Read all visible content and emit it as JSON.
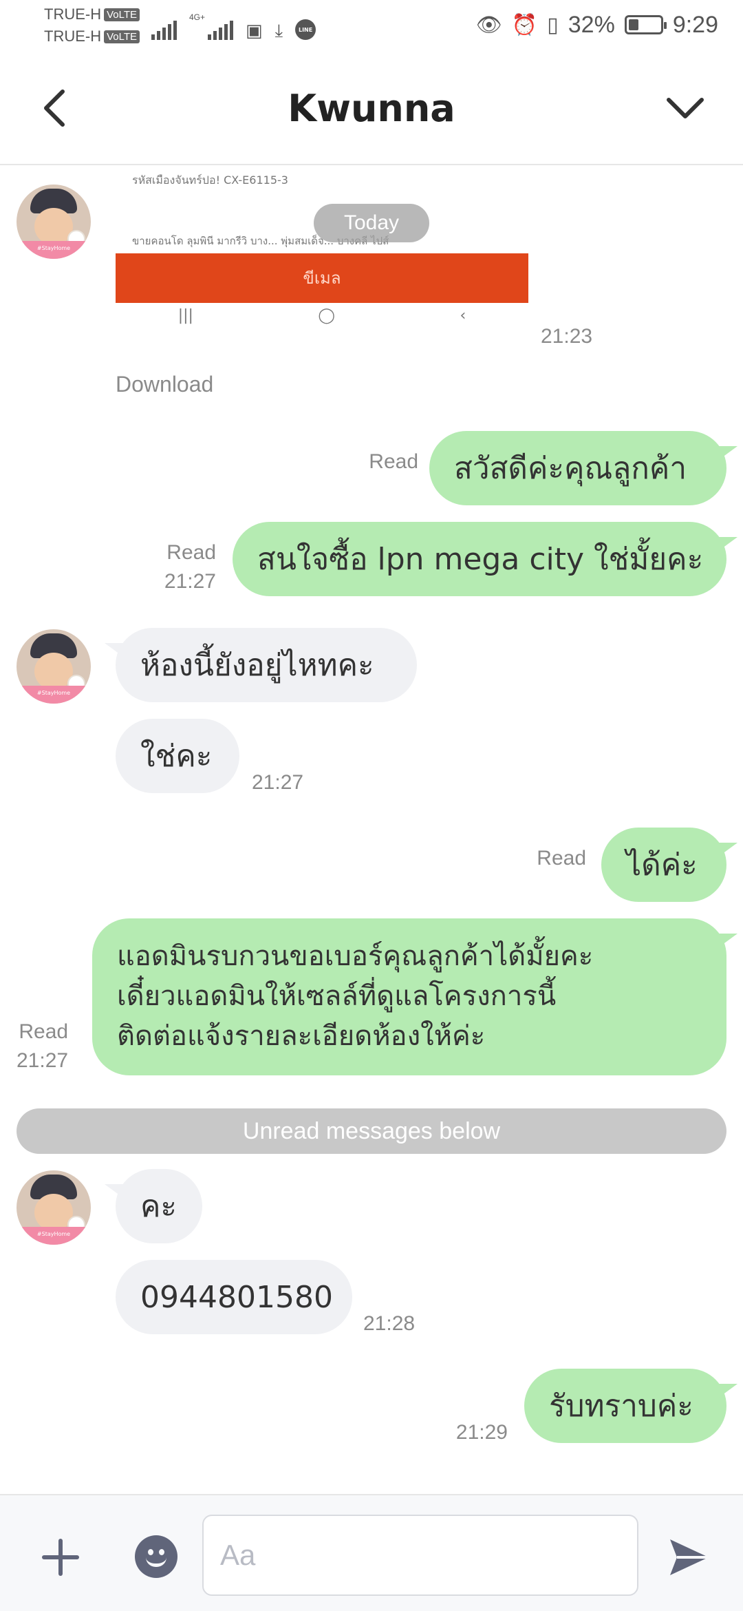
{
  "status_bar": {
    "carrier_1": "TRUE-H",
    "carrier_2": "TRUE-H",
    "volte": "VoLTE",
    "network": "4G+",
    "line_badge": "LINE",
    "battery": "32%",
    "battery_level": 0.32,
    "time": "9:29"
  },
  "header": {
    "title": "Kwunna",
    "back_icon": "chevron-left-icon",
    "menu_icon": "chevron-down-icon"
  },
  "chat": {
    "date_divider": "Today",
    "image_message": {
      "line1": "รหัสเมืองจันทร์ปอ! CX-E6115-3",
      "line2": "ขายคอนโด ลุมพินี มากรีวิ บาง... พุ่มสมเด็จ... บางคลี ไปส์",
      "button_text": "ขีเมล",
      "time": "21:23",
      "download_label": "Download"
    },
    "msg_out_1": {
      "text": "สวัสดีค่ะคุณลูกค้า",
      "read": "Read"
    },
    "msg_out_2": {
      "text": "สนใจซื้อ lpn mega city ใช่มั้ยคะ",
      "read": "Read",
      "time": "21:27"
    },
    "msg_in_1": {
      "text": "ห้องนี้ยังอยู่ไหทคะ"
    },
    "msg_in_2": {
      "text": "ใช่คะ",
      "time": "21:27"
    },
    "msg_out_3": {
      "text": "ได้ค่ะ",
      "read": "Read"
    },
    "msg_out_4": {
      "line1": "แอดมินรบกวนขอเบอร์คุณลูกค้าได้มั้ยคะ",
      "line2": "เดี๋ยวแอดมินให้เซลล์ที่ดูแลโครงการนี้",
      "line3": "ติดต่อแจ้งรายละเอียดห้องให้ค่ะ",
      "read": "Read",
      "time": "21:27"
    },
    "unread_divider": "Unread messages below",
    "msg_in_3": {
      "text": "คะ"
    },
    "msg_in_4": {
      "text": "0944801580",
      "time": "21:28"
    },
    "msg_out_5": {
      "text": "รับทราบค่ะ",
      "time": "21:29"
    },
    "avatar_badge": "#StayHome"
  },
  "input_bar": {
    "placeholder": "Aa",
    "value": "",
    "plus_icon": "plus-icon",
    "emoji_icon": "emoji-icon",
    "send_icon": "send-icon"
  }
}
